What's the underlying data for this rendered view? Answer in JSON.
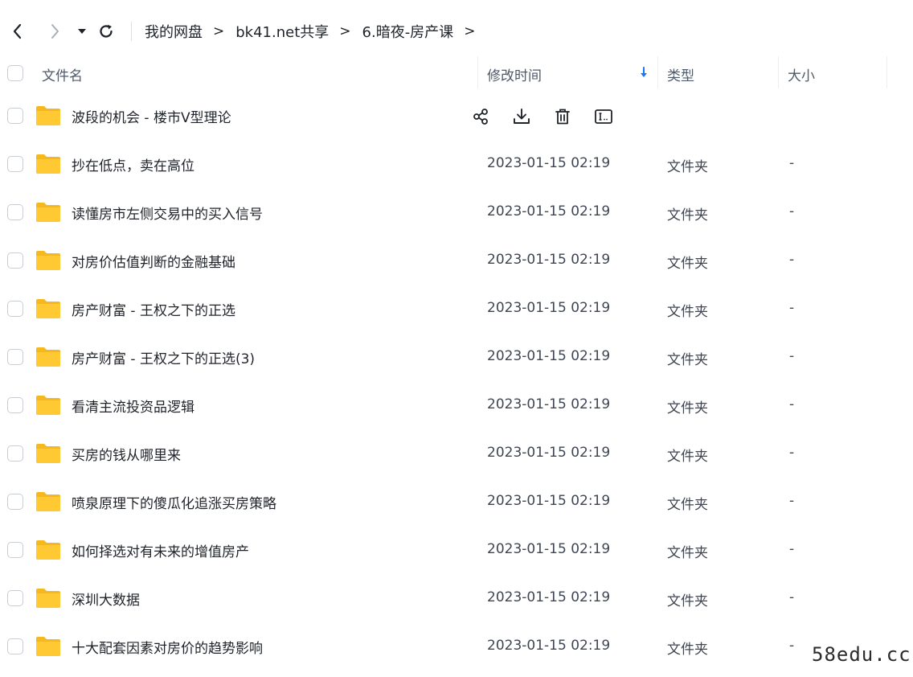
{
  "toolbar": {
    "back_icon": "chevron-left-icon",
    "forward_icon": "chevron-right-icon",
    "history_icon": "caret-down-icon",
    "refresh_icon": "refresh-icon"
  },
  "breadcrumb": {
    "items": [
      "我的网盘",
      "bk41.net共享",
      "6.暗夜-房产课"
    ],
    "separator": ">"
  },
  "header": {
    "name": "文件名",
    "modified": "修改时间",
    "type": "类型",
    "size": "大小",
    "sort_icon": "sort-down-arrow-icon",
    "sort_color": "#1677ff"
  },
  "hover_actions": [
    "share-icon",
    "download-icon",
    "delete-icon",
    "rename-icon"
  ],
  "files": [
    {
      "name": "波段的机会 - 楼市V型理论",
      "date": "",
      "type": "",
      "size": ""
    },
    {
      "name": "抄在低点，卖在高位",
      "date": "2023-01-15 02:19",
      "type": "文件夹",
      "size": "-"
    },
    {
      "name": "读懂房市左侧交易中的买入信号",
      "date": "2023-01-15 02:19",
      "type": "文件夹",
      "size": "-"
    },
    {
      "name": "对房价估值判断的金融基础",
      "date": "2023-01-15 02:19",
      "type": "文件夹",
      "size": "-"
    },
    {
      "name": "房产财富 - 王权之下的正选",
      "date": "2023-01-15 02:19",
      "type": "文件夹",
      "size": "-"
    },
    {
      "name": "房产财富 - 王权之下的正选(3)",
      "date": "2023-01-15 02:19",
      "type": "文件夹",
      "size": "-"
    },
    {
      "name": "看清主流投资品逻辑",
      "date": "2023-01-15 02:19",
      "type": "文件夹",
      "size": "-"
    },
    {
      "name": "买房的钱从哪里来",
      "date": "2023-01-15 02:19",
      "type": "文件夹",
      "size": "-"
    },
    {
      "name": "喷泉原理下的傻瓜化追涨买房策略",
      "date": "2023-01-15 02:19",
      "type": "文件夹",
      "size": "-"
    },
    {
      "name": "如何择选对有未来的增值房产",
      "date": "2023-01-15 02:19",
      "type": "文件夹",
      "size": "-"
    },
    {
      "name": "深圳大数据",
      "date": "2023-01-15 02:19",
      "type": "文件夹",
      "size": "-"
    },
    {
      "name": "十大配套因素对房价的趋势影响",
      "date": "2023-01-15 02:19",
      "type": "文件夹",
      "size": "-"
    }
  ],
  "colors": {
    "folder": "#ffc933",
    "folder_tab": "#f5b820",
    "text": "#1f2329",
    "muted": "#4e5969"
  },
  "watermark": "58edu.cc"
}
